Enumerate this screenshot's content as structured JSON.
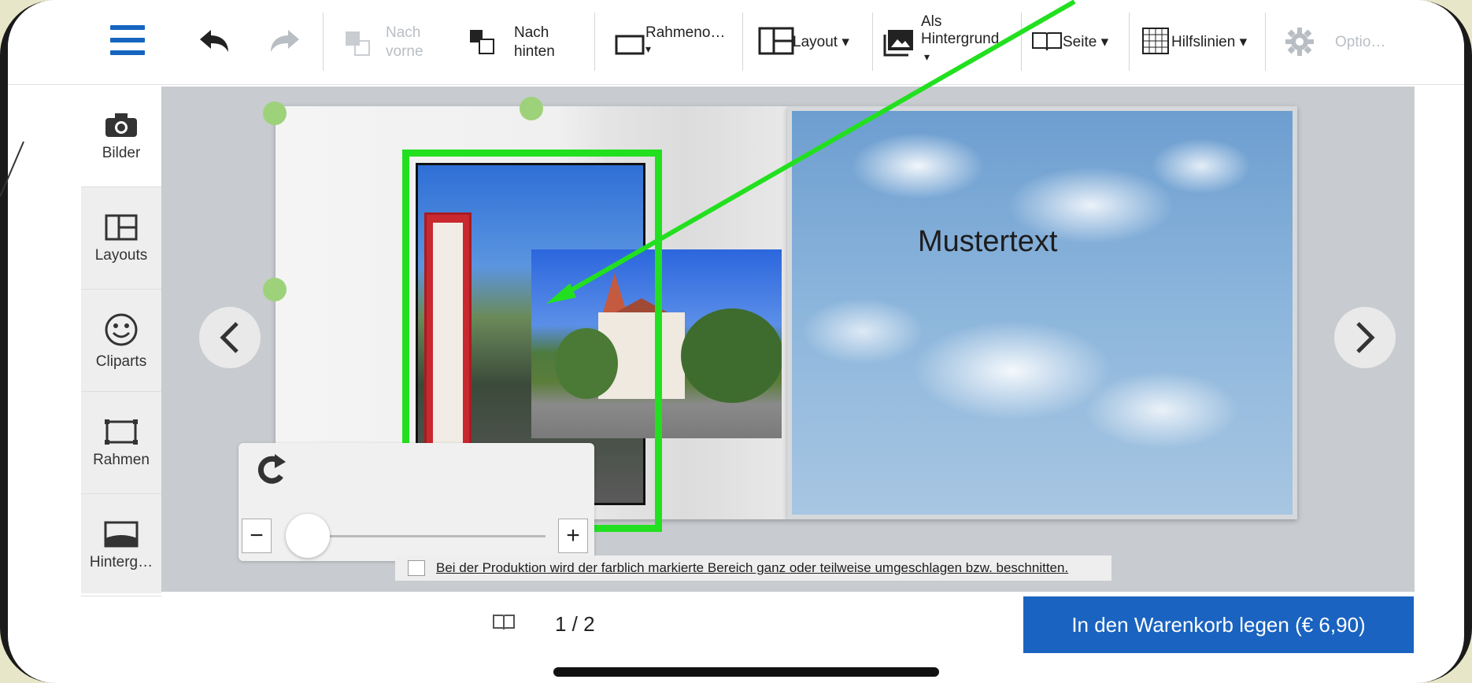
{
  "toolbar": {
    "menu_icon": "hamburger-icon",
    "undo_icon": "undo-icon",
    "redo_icon": "redo-icon",
    "bring_front_line1": "Nach",
    "bring_front_line2": "vorne",
    "send_back_line1": "Nach",
    "send_back_line2": "hinten",
    "frame_label": "Rahmeno…",
    "frame_caret": "▾",
    "layout_label": "Layout ▾",
    "background_line1": "Als",
    "background_line2": "Hintergrund",
    "background_caret": "▾",
    "page_label": "Seite ▾",
    "guides_label": "Hilfslinien ▾",
    "options_label": "Optio…"
  },
  "sidebar": {
    "items": [
      {
        "label": "Bilder",
        "icon": "camera-icon"
      },
      {
        "label": "Layouts",
        "icon": "layout-icon"
      },
      {
        "label": "Cliparts",
        "icon": "smiley-icon"
      },
      {
        "label": "Rahmen",
        "icon": "frame-icon"
      },
      {
        "label": "Hinterg…",
        "icon": "background-icon"
      }
    ]
  },
  "canvas": {
    "right_page_text": "Mustertext",
    "zoom_minus": "−",
    "zoom_plus": "+"
  },
  "notice": {
    "text": "Bei der Produktion wird der farblich markierte Bereich ganz oder teilweise umgeschlagen bzw. beschnitten."
  },
  "footer": {
    "pager": "1 / 2",
    "cart_button": "In den Warenkorb legen (€ 6,90)"
  },
  "colors": {
    "accent": "#1a63c0",
    "selection": "#22e01f"
  }
}
